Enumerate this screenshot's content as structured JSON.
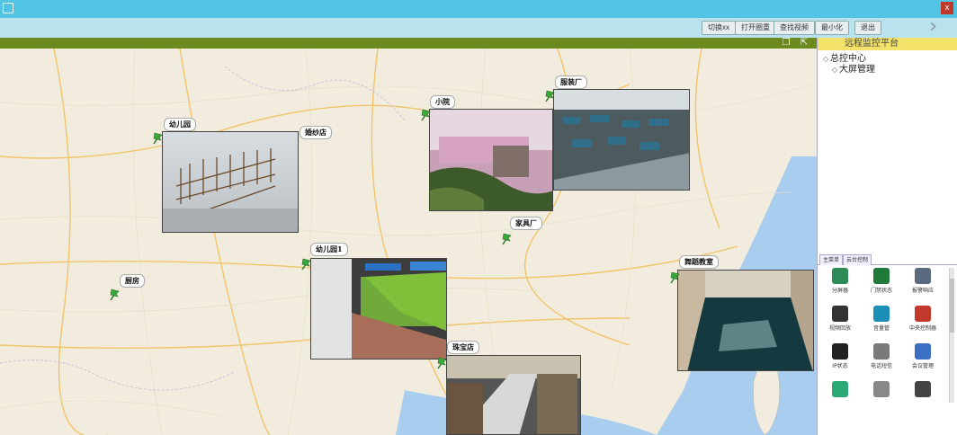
{
  "window": {
    "close_glyph": "x"
  },
  "toolbar": {
    "buttons": [
      "切换xx",
      "打开圈重",
      "查找视频",
      "最小化",
      "退出"
    ],
    "next_glyph": "›"
  },
  "side": {
    "title": "远程监控平台",
    "tree": [
      {
        "mark": "◇",
        "label": "总控中心"
      },
      {
        "mark": "◇",
        "label": "大屏管理"
      }
    ],
    "tabs": [
      "主菜单",
      "云台控制"
    ],
    "tiles": [
      {
        "label": "分屏器",
        "icon": "split-screen-icon",
        "color": "#2e8b57"
      },
      {
        "label": "门禁状态",
        "icon": "door-icon",
        "color": "#1f7a3a"
      },
      {
        "label": "报警响应",
        "icon": "alarm-response-icon",
        "color": "#5a6a80"
      },
      {
        "label": "视频回放",
        "icon": "playback-icon",
        "color": "#333333"
      },
      {
        "label": "音量管",
        "icon": "volume-icon",
        "color": "#1b8fb5"
      },
      {
        "label": "中央控制器",
        "icon": "siren-icon",
        "color": "#c0392b"
      },
      {
        "label": "IP状态",
        "icon": "ip-status-icon",
        "color": "#222222"
      },
      {
        "label": "电话短信",
        "icon": "phone-icon",
        "color": "#7a7a7a"
      },
      {
        "label": "会议管理",
        "icon": "user-icon",
        "color": "#3a6fc4"
      },
      {
        "label": "",
        "icon": "globe-icon",
        "color": "#2aa876"
      },
      {
        "label": "",
        "icon": "screen-icon",
        "color": "#888888"
      },
      {
        "label": "",
        "icon": "speaker-icon",
        "color": "#444444"
      }
    ]
  },
  "map": {
    "pins": [
      {
        "label": "幼儿园"
      },
      {
        "label": "婚纱店"
      },
      {
        "label": "小院"
      },
      {
        "label": "服装厂"
      },
      {
        "label": "家具厂"
      },
      {
        "label": "幼儿园1"
      },
      {
        "label": "厨房"
      },
      {
        "label": "舞蹈教室"
      },
      {
        "label": "珠宝店"
      }
    ]
  }
}
